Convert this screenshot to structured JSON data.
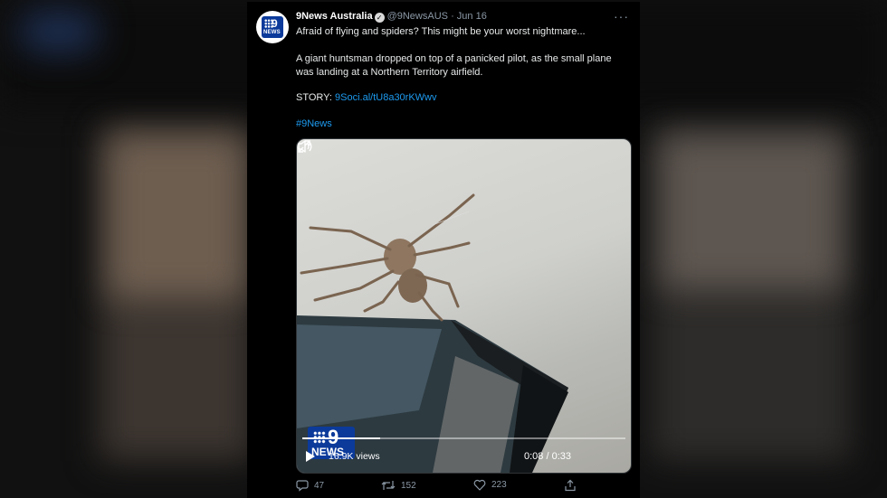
{
  "tweet": {
    "author_name": "9News Australia",
    "handle": "@9NewsAUS",
    "separator": "·",
    "date": "Jun 16",
    "more_glyph": "···",
    "line1": "Afraid of flying and spiders? This might be your worst nightmare...",
    "line2": "A giant huntsman dropped on top of a panicked pilot, as the small plane was landing at a Northern Territory airfield.",
    "story_label": "STORY: ",
    "story_link": "9Soci.al/tU8a30rKWwv",
    "hashtag": "#9News",
    "avatar_logo_digit": "9",
    "avatar_logo_text": "NEWS"
  },
  "video": {
    "watermark_digit": "9",
    "watermark_text": "NEWS",
    "views": "16.9K views",
    "time": "0:08 / 0:33",
    "progress_fraction": 0.242,
    "icons": [
      "play-icon",
      "volume-icon",
      "expand-icon"
    ]
  },
  "actions": {
    "reply_count": "47",
    "retweet_count": "152",
    "like_count": "223",
    "icons": [
      "reply-icon",
      "retweet-icon",
      "like-icon",
      "share-icon"
    ]
  },
  "colors": {
    "link": "#1d9bf0",
    "muted": "#8b98a5",
    "background": "#000000",
    "brand_blue": "#0b3a9a"
  }
}
